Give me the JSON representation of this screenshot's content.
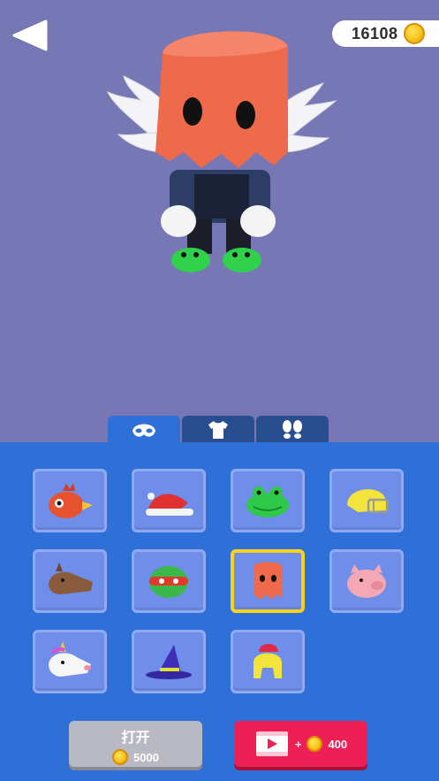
{
  "header": {
    "back_icon": "back-arrow-icon",
    "coins": "16108",
    "coin_icon": "coin-icon"
  },
  "tabs": [
    {
      "name": "tab-hats",
      "icon": "mask-icon",
      "active": true
    },
    {
      "name": "tab-clothes",
      "icon": "shirt-icon",
      "active": false
    },
    {
      "name": "tab-shoes",
      "icon": "footprints-icon",
      "active": false
    }
  ],
  "items": [
    {
      "name": "bird-hat",
      "selected": false
    },
    {
      "name": "santa-hat",
      "selected": false
    },
    {
      "name": "frog-hat",
      "selected": false
    },
    {
      "name": "football-helmet",
      "selected": false
    },
    {
      "name": "horse-mask",
      "selected": false
    },
    {
      "name": "turtle-mask",
      "selected": false
    },
    {
      "name": "ghost-costume",
      "selected": true
    },
    {
      "name": "pig-mask",
      "selected": false
    },
    {
      "name": "unicorn-mask",
      "selected": false
    },
    {
      "name": "wizard-hat",
      "selected": false
    },
    {
      "name": "spartan-helmet",
      "selected": false
    }
  ],
  "buttons": {
    "open_label": "打开",
    "open_cost": "5000",
    "video_plus": "+",
    "video_reward": "400"
  },
  "colors": {
    "background": "#7777b6",
    "panel": "#2f6fd8",
    "tab_inactive": "#284e8f",
    "item_bg": "#6f8ee9",
    "selected_border": "#ffd21a",
    "video_button": "#ee1f55",
    "open_button": "#b9b9c4"
  }
}
